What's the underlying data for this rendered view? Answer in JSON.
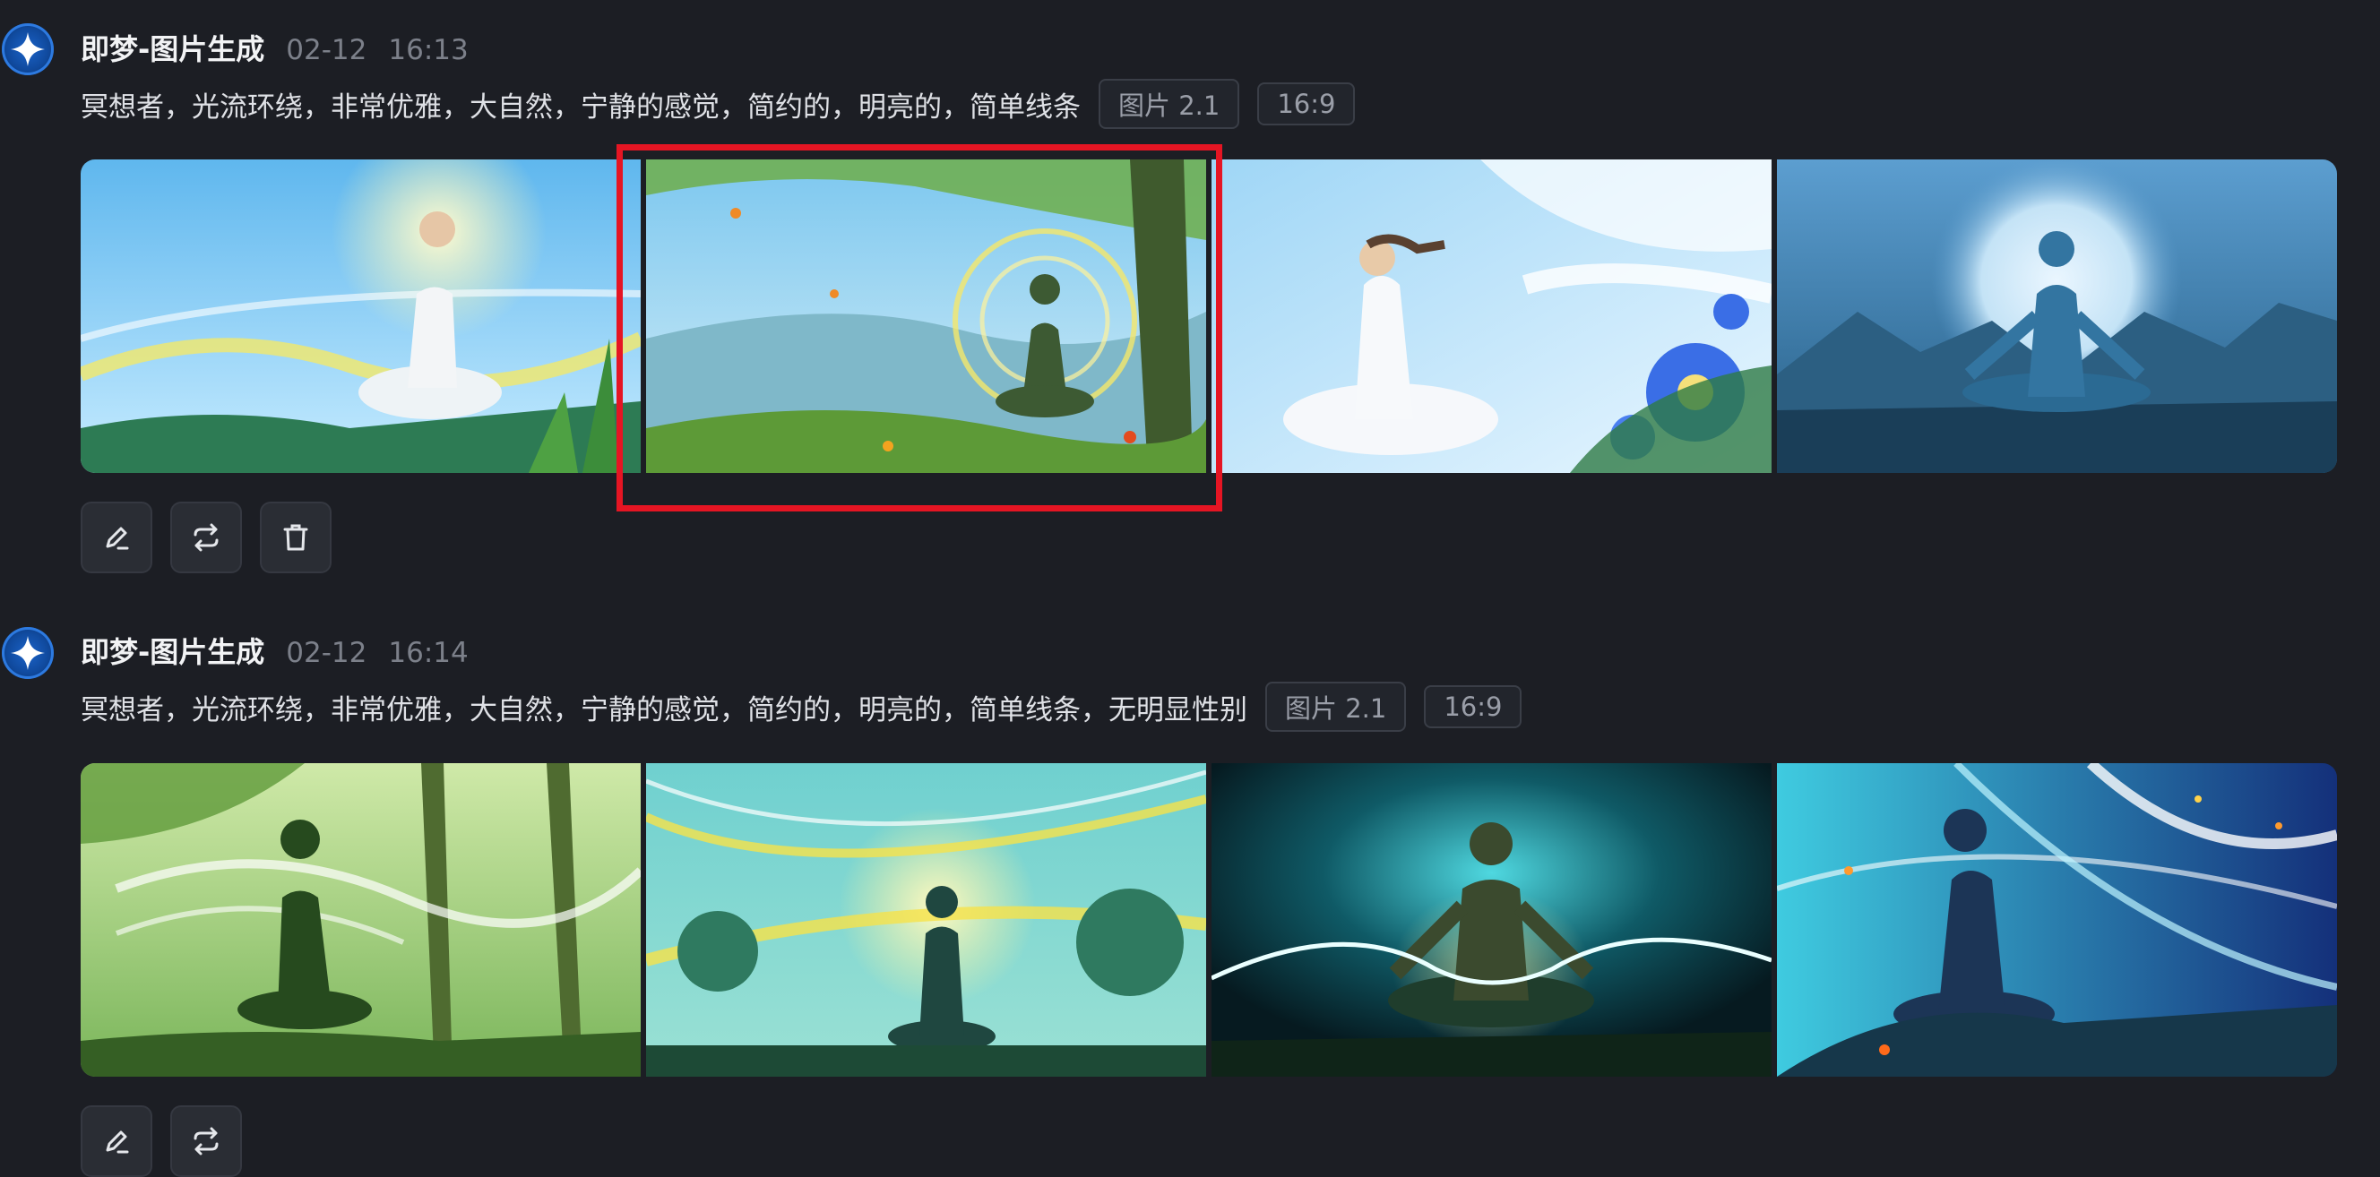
{
  "messages": [
    {
      "app_name": "即梦-图片生成",
      "date": "02-12",
      "time": "16:13",
      "prompt": "冥想者，光流环绕，非常优雅，大自然，宁静的感觉，简约的，明亮的，简单线条",
      "model_tag": "图片 2.1",
      "ratio_tag": "16:9",
      "actions": [
        "edit-icon",
        "regenerate-icon",
        "delete-icon"
      ]
    },
    {
      "app_name": "即梦-图片生成",
      "date": "02-12",
      "time": "16:14",
      "prompt": "冥想者，光流环绕，非常优雅，大自然，宁静的感觉，简约的，明亮的，简单线条，无明显性别",
      "model_tag": "图片 2.1",
      "ratio_tag": "16:9",
      "actions": [
        "edit-icon",
        "regenerate-icon"
      ]
    }
  ],
  "colors": {
    "background": "#1c1e24",
    "highlight": "#e51523",
    "avatar": "#1b63c9"
  }
}
